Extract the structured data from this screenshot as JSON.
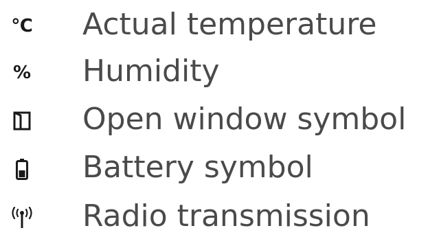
{
  "items": [
    {
      "icon": "celsius-icon",
      "symbol": "℃",
      "label": "Actual temperature"
    },
    {
      "icon": "percent-icon",
      "symbol": "%",
      "label": "Humidity"
    },
    {
      "icon": "open-window-icon",
      "label": "Open window symbol"
    },
    {
      "icon": "battery-icon",
      "label": "Battery symbol"
    },
    {
      "icon": "radio-transmission-icon",
      "label": "Radio transmission"
    }
  ],
  "colors": {
    "text": "#4a4a4a",
    "icon": "#1a1a1a",
    "background": "#ffffff"
  }
}
